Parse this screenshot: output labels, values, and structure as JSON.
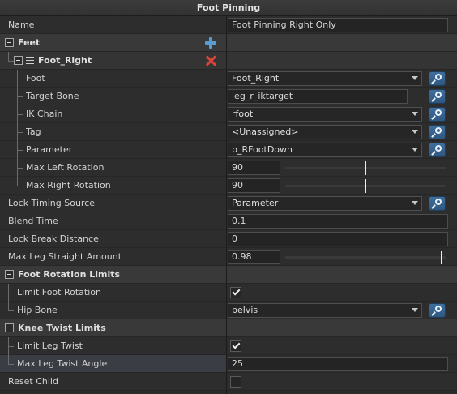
{
  "panel": {
    "title": "Foot Pinning"
  },
  "rows": {
    "name": {
      "label": "Name",
      "value": "Foot Pinning Right Only"
    },
    "feet": {
      "label": "Feet"
    },
    "foot_right": {
      "label": "Foot_Right"
    },
    "foot": {
      "label": "Foot",
      "value": "Foot_Right"
    },
    "target_bone": {
      "label": "Target Bone",
      "value": "leg_r_iktarget"
    },
    "ik_chain": {
      "label": "IK Chain",
      "value": "rfoot"
    },
    "tag": {
      "label": "Tag",
      "value": "<Unassigned>"
    },
    "parameter": {
      "label": "Parameter",
      "value": "b_RFootDown"
    },
    "max_left_rotation": {
      "label": "Max Left Rotation",
      "value": "90",
      "level": 0.5
    },
    "max_right_rotation": {
      "label": "Max Right Rotation",
      "value": "90",
      "level": 0.5
    },
    "lock_timing_source": {
      "label": "Lock Timing Source",
      "value": "Parameter"
    },
    "blend_time": {
      "label": "Blend Time",
      "value": "0.1"
    },
    "lock_break_distance": {
      "label": "Lock Break Distance",
      "value": "0"
    },
    "max_leg_straight_amount": {
      "label": "Max Leg Straight Amount",
      "value": "0.98",
      "level": 0.98
    },
    "foot_rotation_limits": {
      "label": "Foot Rotation Limits"
    },
    "limit_foot_rotation": {
      "label": "Limit Foot Rotation",
      "checked": true
    },
    "hip_bone": {
      "label": "Hip Bone",
      "value": "pelvis"
    },
    "knee_twist_limits": {
      "label": "Knee Twist Limits"
    },
    "limit_leg_twist": {
      "label": "Limit Leg Twist",
      "checked": true
    },
    "max_leg_twist_angle": {
      "label": "Max Leg Twist Angle",
      "value": "25"
    },
    "reset_child": {
      "label": "Reset Child",
      "checked": false
    }
  },
  "icons": {
    "add": "plus-icon",
    "remove": "close-icon",
    "search": "search-icon",
    "expand": "collapse-icon",
    "item": "menu-icon"
  },
  "colors": {
    "add_icon": "#5b9bd4",
    "remove_icon": "#d9443a",
    "search_button": "#3f6f9e",
    "highlight_row": "#3b3d44"
  }
}
